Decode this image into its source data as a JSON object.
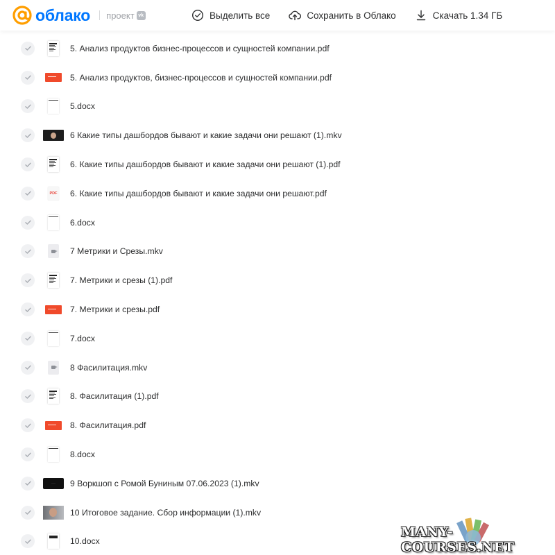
{
  "header": {
    "brand_name": "облако",
    "brand_project": "проект",
    "vk_badge": "vk",
    "actions": {
      "select_all": "Выделить все",
      "save_to_cloud": "Сохранить в Облако",
      "download": "Скачать 1.34 ГБ"
    }
  },
  "files": [
    {
      "name": "5. Анализ продуктов бизнес-процессов и сущностей компании.pdf",
      "thumb": "doc"
    },
    {
      "name": "5. Анализ продуктов, бизнес-процессов и сущностей компании.pdf",
      "thumb": "red"
    },
    {
      "name": "5.docx",
      "thumb": "docx"
    },
    {
      "name": "6 Какие типы дашбордов бывают и какие задачи они решают (1).mkv",
      "thumb": "video"
    },
    {
      "name": "6. Какие типы дашбордов бывают и какие задачи они решают (1).pdf",
      "thumb": "doc"
    },
    {
      "name": "6. Какие типы дашбордов бывают и какие задачи они решают.pdf",
      "thumb": "pdf"
    },
    {
      "name": "6.docx",
      "thumb": "docx"
    },
    {
      "name": "7 Метрики и Срезы.mkv",
      "thumb": "vidicon"
    },
    {
      "name": "7. Метрики и срезы (1).pdf",
      "thumb": "doc"
    },
    {
      "name": "7. Метрики и срезы.pdf",
      "thumb": "red"
    },
    {
      "name": "7.docx",
      "thumb": "docx"
    },
    {
      "name": "8 Фасилитация.mkv",
      "thumb": "vidicon"
    },
    {
      "name": "8. Фасилитация (1).pdf",
      "thumb": "doc"
    },
    {
      "name": "8. Фасилитация.pdf",
      "thumb": "red"
    },
    {
      "name": "8.docx",
      "thumb": "docx"
    },
    {
      "name": "9 Воркшоп с Ромой Буниным 07.06.2023 (1).mkv",
      "thumb": "black"
    },
    {
      "name": "10 Итоговое задание. Сбор информации (1).mkv",
      "thumb": "face"
    },
    {
      "name": "10.docx",
      "thumb": "darkdoc"
    }
  ],
  "pdf_thumb_label": "PDF",
  "watermark": "MANY-COURSES.NET",
  "colors": {
    "brand": "#0077ff",
    "accent_orange": "#ff9e00",
    "pdf_red": "#f04a2b"
  }
}
